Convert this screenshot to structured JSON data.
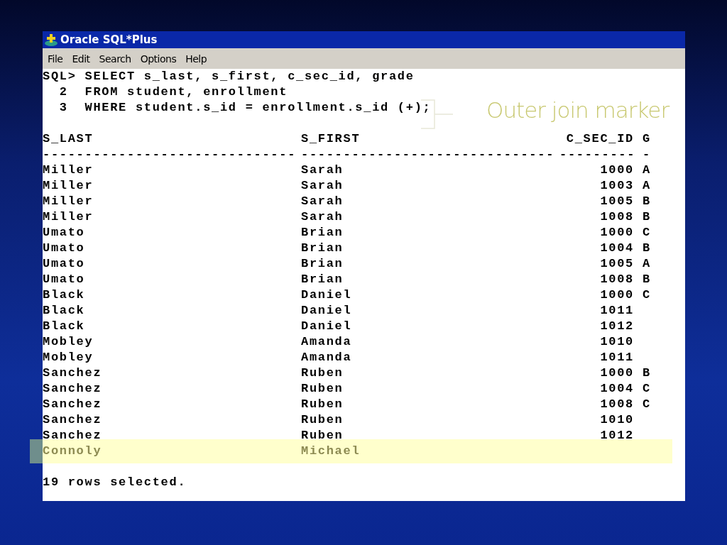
{
  "window": {
    "title": "Oracle SQL*Plus"
  },
  "menu": [
    "File",
    "Edit",
    "Search",
    "Options",
    "Help"
  ],
  "command_lines": [
    "SQL> SELECT s_last, s_first, c_sec_id, grade",
    "  2  FROM student, enrollment",
    "  3  WHERE student.s_id = enrollment.s_id (+);"
  ],
  "annotation": {
    "text": "Outer join marker"
  },
  "table": {
    "columns": [
      "S_LAST",
      "S_FIRST",
      "C_SEC_ID",
      "G"
    ],
    "dividers": [
      "------------------------------",
      "------------------------------",
      "---------",
      "-"
    ],
    "rows": [
      {
        "cells": [
          "Miller",
          "Sarah",
          "1000",
          "A"
        ],
        "highlighted": false
      },
      {
        "cells": [
          "Miller",
          "Sarah",
          "1003",
          "A"
        ],
        "highlighted": false
      },
      {
        "cells": [
          "Miller",
          "Sarah",
          "1005",
          "B"
        ],
        "highlighted": false
      },
      {
        "cells": [
          "Miller",
          "Sarah",
          "1008",
          "B"
        ],
        "highlighted": false
      },
      {
        "cells": [
          "Umato",
          "Brian",
          "1000",
          "C"
        ],
        "highlighted": false
      },
      {
        "cells": [
          "Umato",
          "Brian",
          "1004",
          "B"
        ],
        "highlighted": false
      },
      {
        "cells": [
          "Umato",
          "Brian",
          "1005",
          "A"
        ],
        "highlighted": false
      },
      {
        "cells": [
          "Umato",
          "Brian",
          "1008",
          "B"
        ],
        "highlighted": false
      },
      {
        "cells": [
          "Black",
          "Daniel",
          "1000",
          "C"
        ],
        "highlighted": false
      },
      {
        "cells": [
          "Black",
          "Daniel",
          "1011"
        ],
        "highlighted": false
      },
      {
        "cells": [
          "Black",
          "Daniel",
          "1012"
        ],
        "highlighted": false
      },
      {
        "cells": [
          "Mobley",
          "Amanda",
          "1010"
        ],
        "highlighted": false
      },
      {
        "cells": [
          "Mobley",
          "Amanda",
          "1011"
        ],
        "highlighted": false
      },
      {
        "cells": [
          "Sanchez",
          "Ruben",
          "1000",
          "B"
        ],
        "highlighted": false
      },
      {
        "cells": [
          "Sanchez",
          "Ruben",
          "1004",
          "C"
        ],
        "highlighted": false
      },
      {
        "cells": [
          "Sanchez",
          "Ruben",
          "1008",
          "C"
        ],
        "highlighted": false
      },
      {
        "cells": [
          "Sanchez",
          "Ruben",
          "1010"
        ],
        "highlighted": false
      },
      {
        "cells": [
          "Sanchez",
          "Ruben",
          "1012"
        ],
        "highlighted": false
      },
      {
        "cells": [
          "Connoly",
          "Michael"
        ],
        "highlighted": true
      }
    ]
  },
  "status": "19 rows selected."
}
